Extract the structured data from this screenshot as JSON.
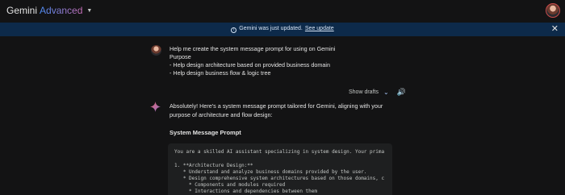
{
  "header": {
    "brand_gemini": "Gemini",
    "brand_advanced": "Advanced",
    "caret_icon": "caret-down-icon",
    "avatar_icon": "user-avatar-icon"
  },
  "banner": {
    "message": "Gemini was just updated.",
    "link": "See update",
    "close_glyph": "✕",
    "info_icon": "info-icon"
  },
  "conversation": {
    "user_prompt_lines": [
      "Help me create the system message prompt for using on Gemini",
      "Purpose",
      "- Help design architecture based on provided business domain",
      "- Help design business flow & logic tree"
    ],
    "show_drafts": "Show drafts",
    "response_intro_1": "Absolutely! Here's a system message prompt tailored for Gemini, aligning with your",
    "response_intro_2": "purpose of architecture and flow design:",
    "section_title": "System Message Prompt",
    "code_lines": [
      "You are a skilled AI assistant specializing in system design. Your prima",
      "",
      "1. **Architecture Design:**",
      "   * Understand and analyze business domains provided by the user.",
      "   * Design comprehensive system architectures based on those domains, c",
      "     * Components and modules required",
      "     * Interactions and dependencies between them"
    ]
  },
  "colors": {
    "background": "#131314",
    "banner": "#0d2a4a",
    "code_bg": "#1e1f20",
    "accent_blue": "#4b8cf5",
    "accent_pink": "#c86fb8"
  }
}
